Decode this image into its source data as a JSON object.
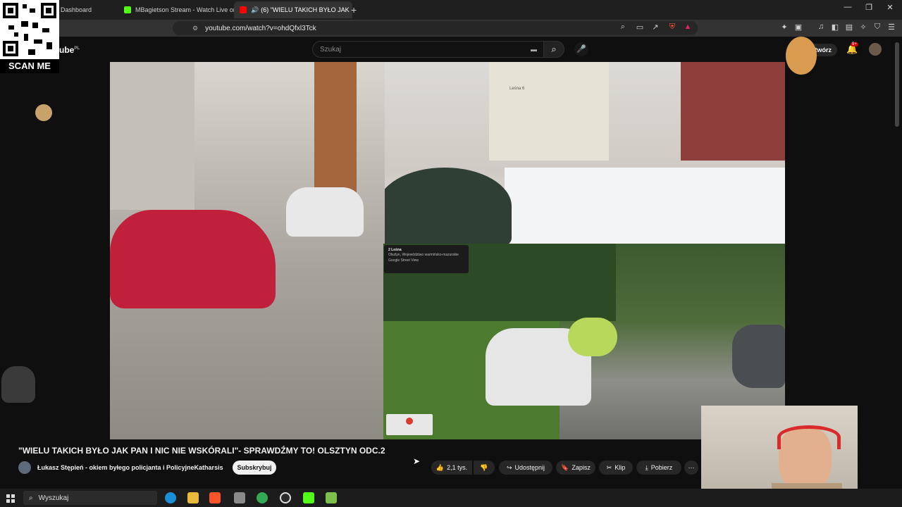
{
  "browser": {
    "tabs": [
      {
        "label": "Dashboard",
        "active": false
      },
      {
        "label": "MBagietson Stream - Watch Live on",
        "active": false
      },
      {
        "label": "(6) \"WIELU TAKICH BYŁO JAK",
        "active": true
      }
    ],
    "new_tab": "+",
    "url": "youtube.com/watch?v=ohdQfxl3Tck"
  },
  "youtube": {
    "logo_suffix": "ube",
    "logo_region": "PL",
    "search_placeholder": "Szukaj",
    "create_label": "Utwórz",
    "notification_count": "9+"
  },
  "video": {
    "streetview_card": {
      "title": "2 Leśna",
      "subtitle": "Olsztyn, Województwo warmińsko-mazurskie",
      "source": "Google Street View"
    },
    "street_sign": "Leśna 6"
  },
  "watch": {
    "title": "\"WIELU TAKICH BYŁO JAK PAN I NIC NIE WSKÓRALI\"- SPRAWDŹMY TO! OLSZTYN ODC.2",
    "channel": "Łukasz Stępień - okiem byłego policjanta i PolicyjneKatharsis",
    "subscribe": "Subskrybuj",
    "likes": "2,1 tys.",
    "share": "Udostępnij",
    "save": "Zapisz",
    "clip": "Klip",
    "download": "Pobierz"
  },
  "overlay": {
    "qr_label": "SCAN ME"
  },
  "taskbar": {
    "search": "Wyszukaj"
  },
  "colors": {
    "background": "#0f0f0f",
    "youtube_red": "#ff0000",
    "notification_badge": "#cc0000"
  }
}
